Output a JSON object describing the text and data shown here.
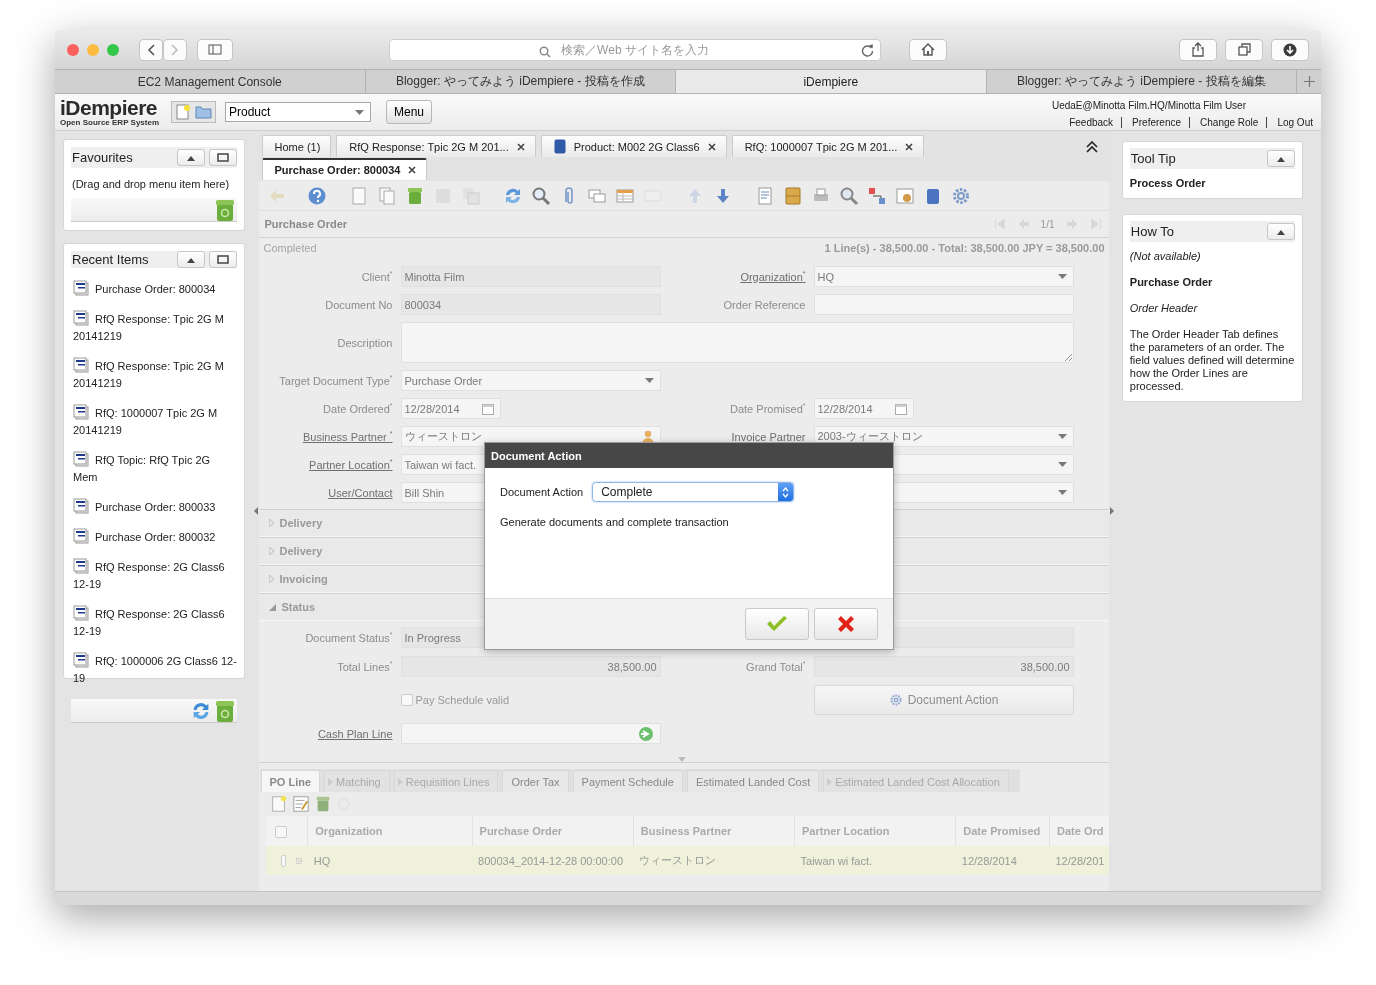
{
  "browser": {
    "address_placeholder": "検索／Web サイト名を入力",
    "tabs": [
      {
        "label": "EC2 Management Console",
        "selected": false
      },
      {
        "label": "Blogger: やってみよう iDempiere - 投稿を作成",
        "selected": false
      },
      {
        "label": "iDempiere",
        "selected": true
      },
      {
        "label": "Blogger: やってみよう iDempiere - 投稿を編集",
        "selected": false
      }
    ]
  },
  "header": {
    "logo": "iDempiere",
    "logo_tagline": "Open Source ERP System",
    "search_type": "Product",
    "menu_button": "Menu",
    "user": "UedaE@Minotta Film.HQ/Minotta Film User",
    "links": [
      "Feedback",
      "Preference",
      "Change Role",
      "Log Out"
    ]
  },
  "favourites": {
    "title": "Favourites",
    "hint": "(Drag and drop menu item here)"
  },
  "recent_items": {
    "title": "Recent Items",
    "items": [
      "Purchase Order: 800034",
      "RfQ Response: Tpic 2G M 20141219",
      "RfQ Response: Tpic 2G M 20141219",
      "RfQ: 1000007 Tpic 2G M 20141219",
      "RfQ Topic: RfQ Tpic 2G Mem",
      "Purchase Order: 800033",
      "Purchase Order: 800032",
      "RfQ Response: 2G Class6 12-19",
      "RfQ Response: 2G Class6 12-19",
      "RfQ: 1000006 2G Class6 12-19"
    ]
  },
  "window_tabs": [
    {
      "label": "Home (1)",
      "kind": "plain",
      "closable": false,
      "selected": false
    },
    {
      "label": "RfQ Response: Tpic 2G M 201...",
      "kind": "plain",
      "closable": true,
      "selected": false
    },
    {
      "label": "Product: M002 2G Class6",
      "kind": "product",
      "closable": true,
      "selected": false
    },
    {
      "label": "RfQ: 1000007 Tpic 2G M 201...",
      "kind": "plain",
      "closable": true,
      "selected": false
    },
    {
      "label": "Purchase Order: 800034",
      "kind": "plain",
      "closable": true,
      "selected": true
    }
  ],
  "record": {
    "title": "Purchase Order",
    "navigation": "1/1",
    "status": "Completed",
    "summary": "1 Line(s) - 38,500.00 - Total: 38,500.00 JPY = 38,500.00"
  },
  "form": {
    "rows": [
      {
        "cells": [
          {
            "label": "Client$^{*}$",
            "kind": "text",
            "value": "Minotta Film",
            "readonly": true,
            "link": false
          },
          {
            "label": "Organization$^{*}$",
            "kind": "select",
            "value": "HQ",
            "readonly": false,
            "link": true
          }
        ]
      },
      {
        "cells": [
          {
            "label": "Document No",
            "kind": "text",
            "value": "800034",
            "readonly": true,
            "link": false
          },
          {
            "label": "Order Reference",
            "kind": "text",
            "readonly": false,
            "link": false
          }
        ]
      },
      {
        "cells": [
          {
            "label": "Description",
            "kind": "textarea",
            "readonly": false,
            "link": false
          }
        ]
      },
      {
        "cells": [
          {
            "label": "Target Document Type$^{*}$",
            "kind": "select",
            "value": "Purchase Order",
            "readonly": false,
            "link": false
          }
        ]
      },
      {
        "cells": [
          {
            "label": "Date Ordered$^{*}$",
            "kind": "date",
            "value": "12/28/2014",
            "readonly": false,
            "link": false
          },
          {
            "label": "Date Promised$^{*}$",
            "kind": "date",
            "value": "12/28/2014",
            "readonly": false,
            "link": false
          }
        ]
      },
      {
        "cells": [
          {
            "label": "Business Partner $^{*}$",
            "kind": "search",
            "value": "ウィーストロン",
            "readonly": false,
            "link": true
          },
          {
            "label": "Invoice Partner",
            "kind": "select",
            "value": "2003-ウィーストロン",
            "readonly": false,
            "link": true
          }
        ]
      },
      {
        "cells": [
          {
            "label": "Partner Location$^{*}$",
            "kind": "text",
            "value": "Taiwan wi fact.",
            "readonly": false,
            "link": true
          },
          {
            "kind": "select",
            "readonly": false
          }
        ]
      },
      {
        "cells": [
          {
            "label": "User/Contact",
            "kind": "text",
            "value": "Bill Shin",
            "readonly": false,
            "link": true
          },
          {
            "kind": "select",
            "readonly": false
          }
        ]
      }
    ],
    "sections": [
      {
        "label": "Delivery",
        "expanded": false
      },
      {
        "label": "Delivery",
        "expanded": false
      },
      {
        "label": "Invoicing",
        "expanded": false
      },
      {
        "label": "Status",
        "expanded": true,
        "rows": [
          {
            "cells": [
              {
                "label": "Document Status$^{*}$",
                "kind": "text",
                "value": "In Progress",
                "readonly": true,
                "link": false
              },
              {
                "kind": "text",
                "readonly": true
              }
            ]
          },
          {
            "cells": [
              {
                "label": "Total Lines$^{*}$",
                "kind": "number",
                "value": "38,500.00",
                "readonly": true,
                "link": false
              },
              {
                "label": "Grand Total$^{*}$",
                "kind": "number",
                "value": "38,500.00",
                "readonly": true,
                "link": false
              }
            ]
          },
          {
            "cells": [
              {
                "label": "Pay Schedule valid",
                "kind": "checkbox",
                "checked": false
              },
              {
                "label": "Document Action",
                "kind": "button"
              }
            ]
          },
          {
            "cells": [
              {
                "label": "Cash Plan Line",
                "kind": "lookup",
                "readonly": false,
                "link": true
              }
            ]
          }
        ]
      }
    ]
  },
  "detail_tabs": [
    {
      "label": "PO Line",
      "selected": true,
      "disabled": false
    },
    {
      "label": "Matching",
      "selected": false,
      "disabled": true
    },
    {
      "label": "Requisition Lines",
      "selected": false,
      "disabled": true
    },
    {
      "label": "Order Tax",
      "selected": false,
      "disabled": false
    },
    {
      "label": "Payment Schedule",
      "selected": false,
      "disabled": false
    },
    {
      "label": "Estimated Landed Cost",
      "selected": false,
      "disabled": false
    },
    {
      "label": "Estimated Landed Cost Allocation",
      "selected": false,
      "disabled": true
    }
  ],
  "grid": {
    "all_checked": false,
    "columns": [
      "Organization",
      "Purchase Order",
      "Business Partner",
      "Partner Location",
      "Date Promised",
      "Date Ord"
    ],
    "rows": [
      {
        "selected": true,
        "checked": false,
        "cells": [
          "HQ",
          "800034_2014-12-28 00:00:00",
          "ウィーストロン",
          "Taiwan wi fact.",
          "12/28/2014",
          "12/28/201"
        ]
      }
    ]
  },
  "tool_tip": {
    "title": "Tool Tip",
    "text": "Process Order"
  },
  "how_to": {
    "title": "How To",
    "availability": "(Not available)",
    "window": "Purchase Order",
    "tab": "Order Header",
    "description": "The Order Header Tab defines the parameters of an order. The field values defined will determine how the Order Lines are processed."
  },
  "dialog": {
    "title": "Document Action",
    "field_label": "Document Action",
    "value": "Complete",
    "description": "Generate documents and complete transaction"
  }
}
